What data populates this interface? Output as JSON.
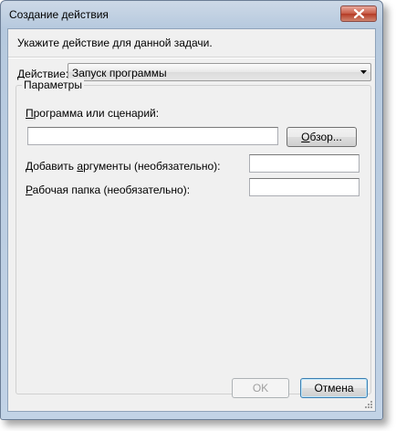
{
  "window": {
    "title": "Создание действия"
  },
  "dialog": {
    "prompt": "Укажите действие для данной задачи.",
    "action": {
      "label_pre": "",
      "label_accel": "Д",
      "label_post": "ействие:",
      "selected": "Запуск программы"
    },
    "params": {
      "legend": "Параметры",
      "program": {
        "label_accel": "П",
        "label_post": "рограмма или сценарий:",
        "value": ""
      },
      "browse_label_accel": "О",
      "browse_label_post": "бзор...",
      "arguments": {
        "label_pre": "Добавить ",
        "label_accel": "а",
        "label_post": "ргументы (необязательно):",
        "value": ""
      },
      "workdir": {
        "label_accel": "Р",
        "label_post": "абочая папка (необязательно):",
        "value": ""
      }
    },
    "ok_label": "OK",
    "cancel_label": "Отмена"
  },
  "colors": {
    "frame": "#b6c9de",
    "client": "#f0f0f0",
    "close_button": "#c75a45"
  },
  "icons": [
    "close-icon",
    "chevron-down-icon",
    "resize-grip-icon"
  ]
}
